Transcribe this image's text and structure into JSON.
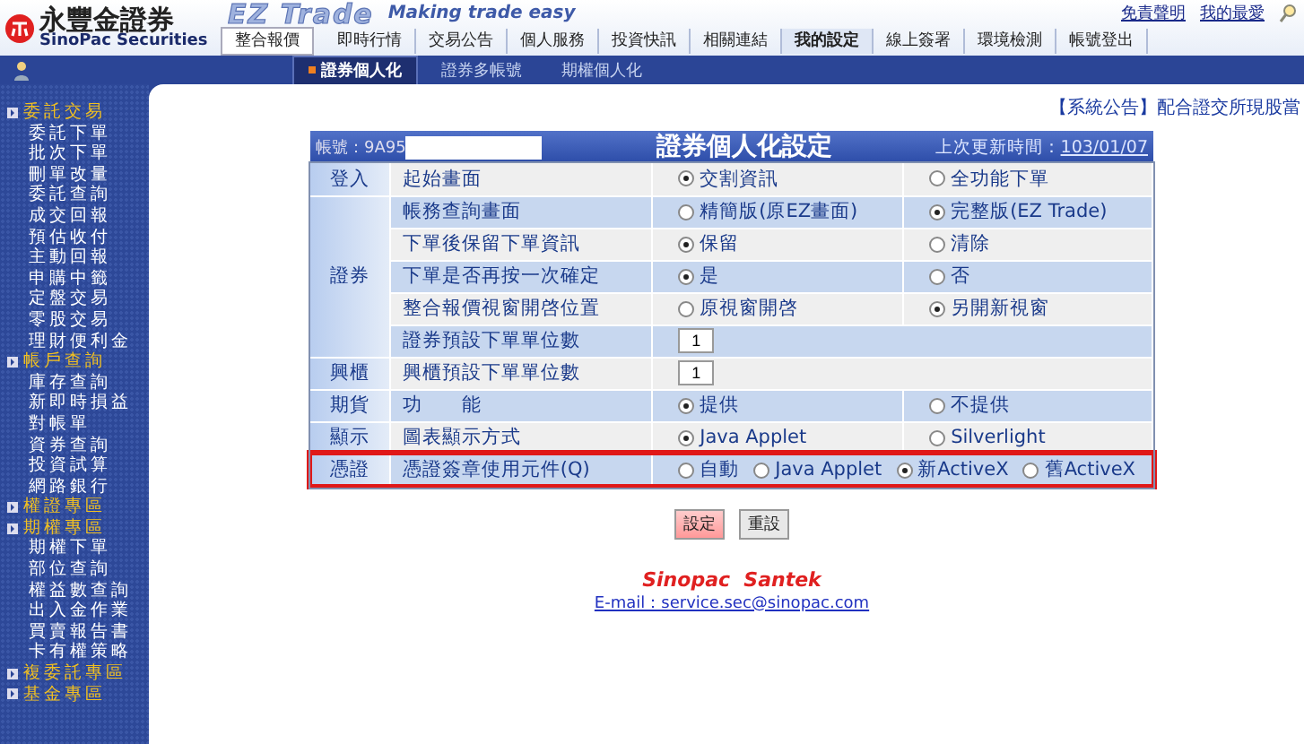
{
  "header": {
    "brand_cn": "永豐金證券",
    "brand_en": "SinoPac Securities",
    "product": "EZ Trade",
    "slogan": "Making trade easy",
    "links": [
      "免責聲明",
      "我的最愛"
    ]
  },
  "nav": [
    {
      "label": "整合報價",
      "kind": "button",
      "selected": false
    },
    {
      "label": "即時行情",
      "kind": "tab",
      "selected": false
    },
    {
      "label": "交易公告",
      "kind": "tab",
      "selected": false
    },
    {
      "label": "個人服務",
      "kind": "tab",
      "selected": false
    },
    {
      "label": "投資快訊",
      "kind": "tab",
      "selected": false
    },
    {
      "label": "相關連結",
      "kind": "tab",
      "selected": false
    },
    {
      "label": "我的設定",
      "kind": "tab",
      "selected": true
    },
    {
      "label": "線上簽署",
      "kind": "tab",
      "selected": false
    },
    {
      "label": "環境檢測",
      "kind": "tab",
      "selected": false
    },
    {
      "label": "帳號登出",
      "kind": "tab",
      "selected": false
    }
  ],
  "subnav": [
    {
      "label": "證券個人化",
      "selected": true
    },
    {
      "label": "證券多帳號",
      "selected": false
    },
    {
      "label": "期權個人化",
      "selected": false
    }
  ],
  "sidebar": [
    {
      "label": "委託交易",
      "children": [
        "委託下單",
        "批次下單",
        "刪單改量",
        "委託查詢",
        "成交回報",
        "預估收付",
        "主動回報",
        "申購中籤",
        "定盤交易",
        "零股交易",
        "理財便利金"
      ]
    },
    {
      "label": "帳戶查詢",
      "children": [
        "庫存查詢",
        "新即時損益",
        "對帳單",
        "資券查詢",
        "投資試算",
        "網路銀行"
      ]
    },
    {
      "label": "權證專區"
    },
    {
      "label": "期權專區",
      "children": [
        "期權下單",
        "部位查詢",
        "權益數查詢",
        "出入金作業",
        "買賣報告書",
        "卡有權策略"
      ]
    },
    {
      "label": "複委託專區"
    },
    {
      "label": "基金專區"
    }
  ],
  "announcement": "【系統公告】配合證交所現股當",
  "settings": {
    "account_label": "帳號：9A95",
    "title": "證券個人化設定",
    "updated_label": "上次更新時間：",
    "updated_date": "103/01/07",
    "groups": [
      {
        "label": "登入",
        "rows": [
          {
            "desc": "起始畫面",
            "kind": "pair",
            "highlighted": false,
            "options": [
              {
                "label": "交割資訊",
                "selected": true
              },
              {
                "label": "全功能下單",
                "selected": false
              }
            ]
          }
        ]
      },
      {
        "label": "證券",
        "rows": [
          {
            "desc": "帳務查詢畫面",
            "kind": "pair",
            "highlighted": false,
            "options": [
              {
                "label": "精簡版(原EZ畫面)",
                "selected": false
              },
              {
                "label": "完整版(EZ Trade)",
                "selected": true
              }
            ]
          },
          {
            "desc": "下單後保留下單資訊",
            "kind": "pair",
            "highlighted": false,
            "options": [
              {
                "label": "保留",
                "selected": true
              },
              {
                "label": "清除",
                "selected": false
              }
            ]
          },
          {
            "desc": "下單是否再按一次確定",
            "kind": "pair",
            "highlighted": false,
            "options": [
              {
                "label": "是",
                "selected": true
              },
              {
                "label": "否",
                "selected": false
              }
            ]
          },
          {
            "desc": "整合報價視窗開啓位置",
            "kind": "pair",
            "highlighted": false,
            "options": [
              {
                "label": "原視窗開啓",
                "selected": false
              },
              {
                "label": "另開新視窗",
                "selected": true
              }
            ]
          },
          {
            "desc": "證券預設下單單位數",
            "kind": "number",
            "highlighted": false,
            "value": "1"
          }
        ]
      },
      {
        "label": "興櫃",
        "rows": [
          {
            "desc": "興櫃預設下單單位數",
            "kind": "number",
            "highlighted": false,
            "value": "1"
          }
        ]
      },
      {
        "label": "期貨",
        "rows": [
          {
            "desc": "功　　能",
            "kind": "pair",
            "highlighted": false,
            "options": [
              {
                "label": "提供",
                "selected": true
              },
              {
                "label": "不提供",
                "selected": false
              }
            ]
          }
        ]
      },
      {
        "label": "顯示",
        "rows": [
          {
            "desc": "圖表顯示方式",
            "kind": "pair",
            "highlighted": false,
            "options": [
              {
                "label": "Java Applet",
                "selected": true
              },
              {
                "label": "Silverlight",
                "selected": false
              }
            ]
          }
        ]
      },
      {
        "label": "憑證",
        "rows": [
          {
            "desc": "憑證簽章使用元件(Q)",
            "kind": "inline",
            "highlighted": true,
            "options": [
              {
                "label": "自動",
                "selected": false
              },
              {
                "label": "Java Applet",
                "selected": false
              },
              {
                "label": "新ActiveX",
                "selected": true
              },
              {
                "label": "舊ActiveX",
                "selected": false
              }
            ]
          }
        ]
      }
    ],
    "buttons": [
      {
        "label": "設定",
        "kind": "primary"
      },
      {
        "label": "重設",
        "kind": "secondary"
      }
    ]
  },
  "footer": {
    "company": "Sinopac  Santek",
    "email": "E-mail：service.sec@sinopac.com"
  }
}
